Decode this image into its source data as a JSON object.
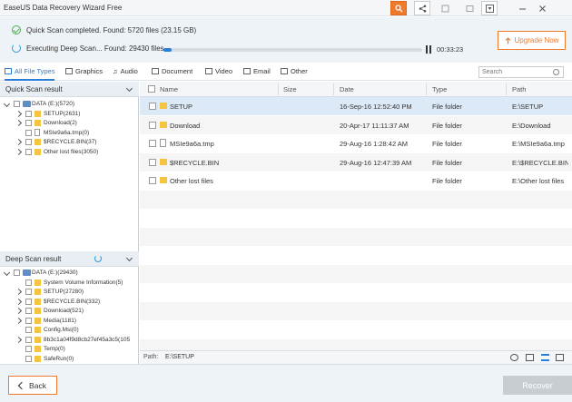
{
  "window": {
    "title": "EaseUS Data Recovery Wizard Free"
  },
  "status": {
    "quick_scan": "Quick Scan completed.  Found: 5720 files (23.15 GB)",
    "deep_scan": "Executing Deep Scan... Found: 29430 files",
    "progress": 0.03,
    "elapsed": "00:33:23",
    "upgrade_label": "Upgrade Now"
  },
  "filters": {
    "tabs": [
      "All File Types",
      "Graphics",
      "Audio",
      "Document",
      "Video",
      "Email",
      "Other"
    ],
    "search_placeholder": "Search"
  },
  "quick_scan_panel": {
    "title": "Quick Scan result",
    "items": [
      "DATA (E:)(5720)",
      "SETUP(2631)",
      "Download(2)",
      "MSIe9a6a.tmp(0)",
      "$RECYCLE.BIN(37)",
      "Other lost files(3050)"
    ]
  },
  "deep_scan_panel": {
    "title": "Deep Scan result",
    "items": [
      "DATA (E:)(29430)",
      "System Volume Information(5)",
      "SETUP(27280)",
      "$RECYCLE.BIN(332)",
      "Download(521)",
      "Media(1181)",
      "Config.Msi(0)",
      "8b3c1a04f9d8cb27ef45a3c5(105",
      "Temp(0)",
      "SafeRun(0)",
      "MSIe9a6a.tmp(0)"
    ]
  },
  "table": {
    "columns": [
      "Name",
      "Size",
      "Date",
      "Type",
      "Path"
    ],
    "rows": [
      {
        "name": "SETUP",
        "size": "",
        "date": "16-Sep-16 12:52:40 PM",
        "type": "File folder",
        "path": "E:\\SETUP"
      },
      {
        "name": "Download",
        "size": "",
        "date": "20-Apr-17 11:11:37 AM",
        "type": "File folder",
        "path": "E:\\Download"
      },
      {
        "name": "MSIe9a6a.tmp",
        "size": "",
        "date": "29-Aug-16 1:28:42 AM",
        "type": "File folder",
        "path": "E:\\MSIe9a6a.tmp"
      },
      {
        "name": "$RECYCLE.BIN",
        "size": "",
        "date": "29-Aug-16 12:47:39 AM",
        "type": "File folder",
        "path": "E:\\$RECYCLE.BIN"
      },
      {
        "name": "Other lost files",
        "size": "",
        "date": "",
        "type": "File folder",
        "path": "E:\\Other lost files"
      }
    ]
  },
  "pathbar": {
    "label": "Path:",
    "value": "E:\\SETUP"
  },
  "footer": {
    "back_label": "Back",
    "recover_label": "Recover"
  },
  "colors": {
    "accent": "#f07a2c",
    "primary": "#2b7ed8",
    "folder": "#f5c542"
  }
}
